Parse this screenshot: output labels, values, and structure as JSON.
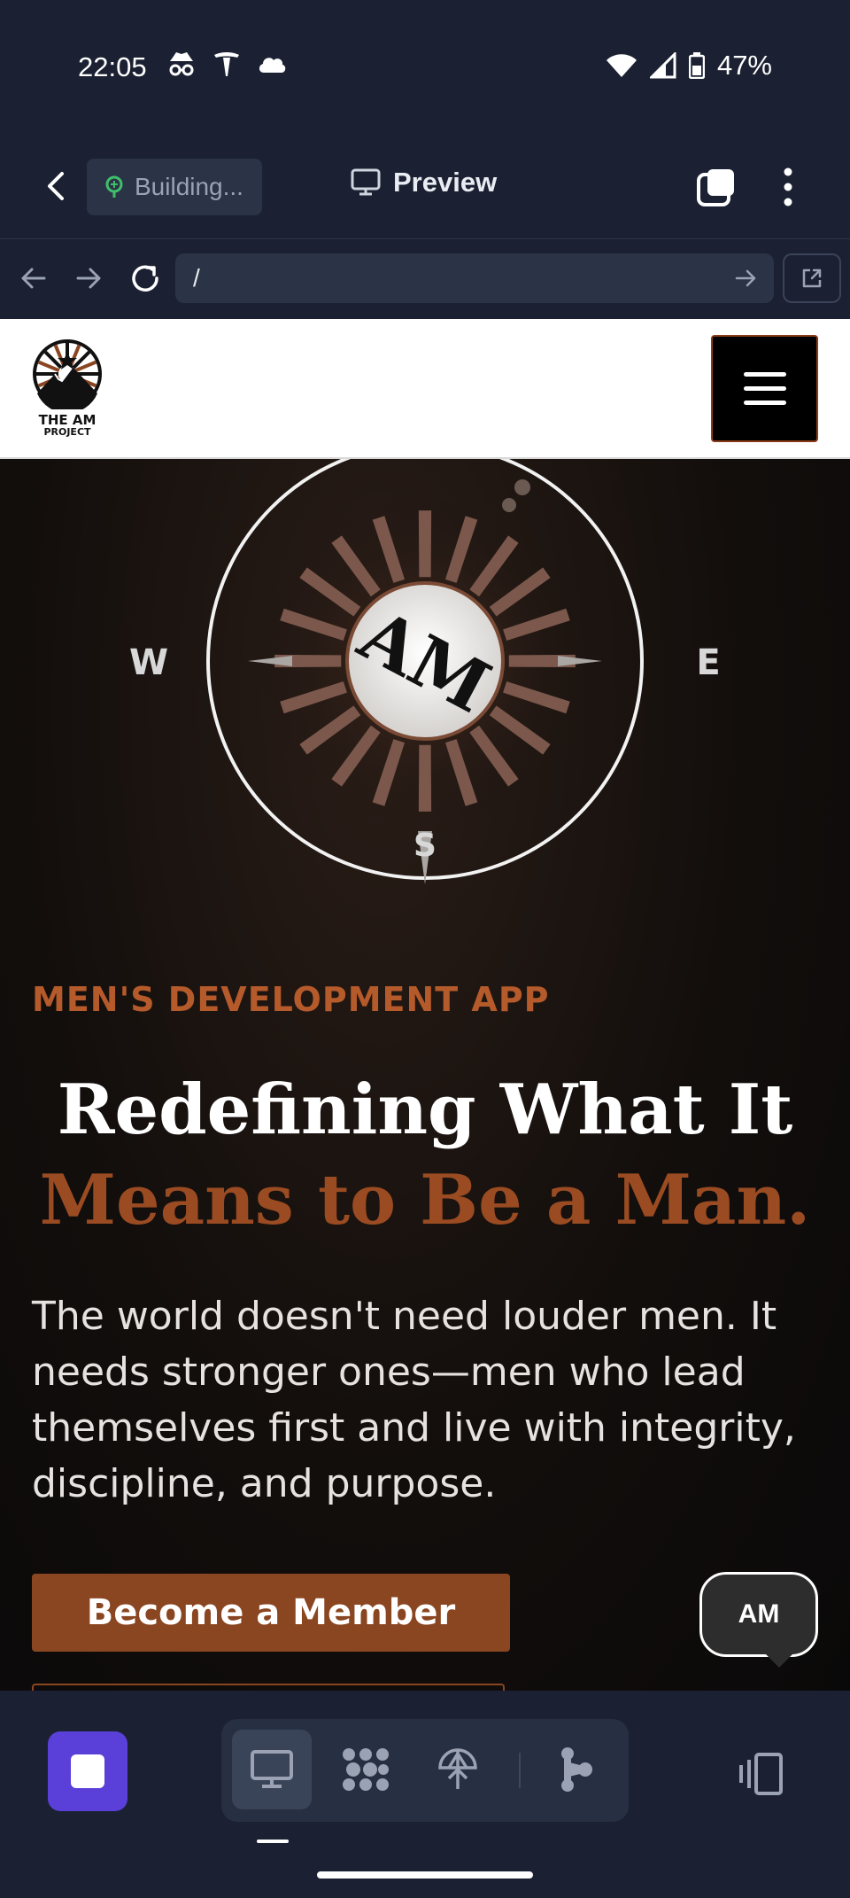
{
  "status_bar": {
    "time": "22:05",
    "battery": "47%",
    "icons_left": [
      "incognito-icon",
      "tesla-icon",
      "cloud-icon"
    ],
    "icons_right": [
      "wifi-icon",
      "signal-icon",
      "battery-icon"
    ]
  },
  "editor_bar": {
    "building_label": "Building...",
    "preview_label": "Preview"
  },
  "url_bar": {
    "url": "/"
  },
  "site": {
    "logo_line1": "THE AM",
    "logo_line2": "PROJECT",
    "compass_center": "AM",
    "compass_west": "W",
    "compass_east": "E",
    "compass_south": "S",
    "eyebrow": "MEN'S DEVELOPMENT APP",
    "title_line1": "Redefining What It",
    "title_line2": "Means to Be a Man.",
    "body": "The world doesn't need louder men. It needs stronger ones—men who lead themselves first and live with integrity, discipline, and purpose.",
    "cta_label": "Become a Member",
    "chat_label": "AM"
  },
  "colors": {
    "accent": "#8a4521",
    "accent_text": "#b55a2a",
    "title_accent": "#9a4b22",
    "app_chrome": "#1b2132",
    "stop_button": "#5a3fd8"
  },
  "bottom_bar": {
    "modes": [
      "desktop-preview-icon",
      "apps-grid-icon",
      "deploy-icon",
      "git-branch-icon"
    ],
    "active_mode": "desktop-preview-icon"
  }
}
